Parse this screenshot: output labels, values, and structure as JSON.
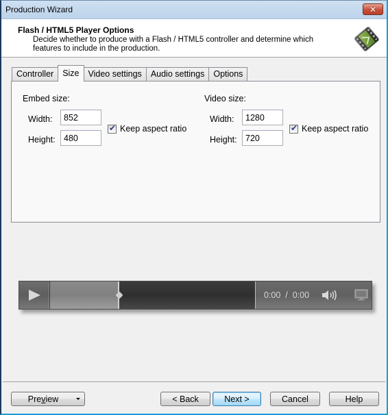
{
  "window": {
    "title": "Production Wizard",
    "close_label": "✕"
  },
  "header": {
    "title": "Flash / HTML5 Player Options",
    "description": "Decide whether to produce with a Flash / HTML5 controller and determine which features to include in the production.",
    "icon": "film-strip-icon"
  },
  "tabs": [
    {
      "label": "Controller",
      "active": false
    },
    {
      "label": "Size",
      "active": true
    },
    {
      "label": "Video settings",
      "active": false
    },
    {
      "label": "Audio settings",
      "active": false
    },
    {
      "label": "Options",
      "active": false
    }
  ],
  "size_tab": {
    "embed": {
      "group_label": "Embed size:",
      "width_label": "Width:",
      "width_value": "852",
      "height_label": "Height:",
      "height_value": "480",
      "keep_aspect_label": "Keep aspect ratio",
      "keep_aspect_checked": true
    },
    "video": {
      "group_label": "Video size:",
      "width_label": "Width:",
      "width_value": "1280",
      "height_label": "Height:",
      "height_value": "720",
      "keep_aspect_label": "Keep aspect ratio",
      "keep_aspect_checked": true
    }
  },
  "player_preview": {
    "current_time": "0:00",
    "separator": "/",
    "total_time": "0:00",
    "buffer_fraction": 0.34,
    "icons": [
      "play-icon",
      "volume-icon",
      "fullscreen-icon"
    ]
  },
  "footer": {
    "preview_label_pre": "Pre",
    "preview_label_mnemonic": "v",
    "preview_label_post": "iew",
    "back_label": "< Back",
    "next_label": "Next >",
    "cancel_label": "Cancel",
    "help_label": "Help"
  }
}
